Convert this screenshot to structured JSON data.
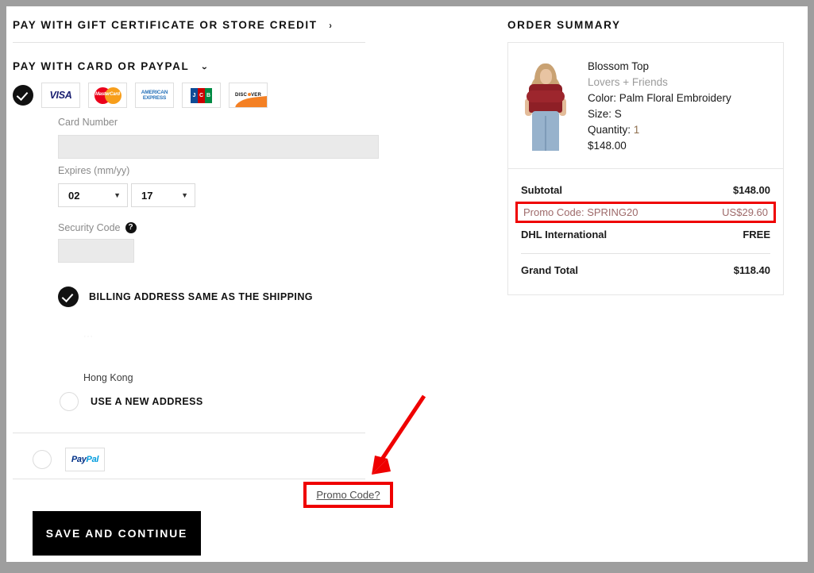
{
  "left": {
    "gift_section": {
      "title": "PAY WITH GIFT CERTIFICATE OR STORE CREDIT",
      "chevron": "›"
    },
    "card_section": {
      "title": "PAY WITH CARD OR PAYPAL",
      "chevron": "⌄"
    },
    "card_logos": [
      {
        "name": "visa-logo",
        "label": "VISA"
      },
      {
        "name": "mastercard-logo",
        "label": "MasterCard"
      },
      {
        "name": "amex-logo",
        "label_line1": "AMERICAN",
        "label_line2": "EXPRESS"
      },
      {
        "name": "jcb-logo",
        "l1": "J",
        "l2": "C",
        "l3": "B"
      },
      {
        "name": "discover-logo",
        "label_pre": "DISC",
        "label_post": "VER"
      }
    ],
    "form": {
      "card_number_label": "Card Number",
      "card_number_value": "",
      "expires_label": "Expires (mm/yy)",
      "expires_month": "02",
      "expires_year": "17",
      "select_arrow": "▼",
      "security_code_label": "Security Code",
      "security_help_icon": "?",
      "security_code_value": ""
    },
    "billing": {
      "same_as_shipping_label": "BILLING ADDRESS SAME AS THE SHIPPING",
      "obscured_address": "···",
      "country": "Hong Kong",
      "new_address_label": "USE A NEW ADDRESS"
    },
    "paypal": {
      "label": "PayPal",
      "pp_a": "Pay",
      "pp_b": "Pal"
    },
    "promo_link": "Promo Code?",
    "save_button": "SAVE AND CONTINUE"
  },
  "summary": {
    "title": "ORDER SUMMARY",
    "product": {
      "name": "Blossom Top",
      "brand": "Lovers + Friends",
      "color": "Color: Palm Floral Embroidery",
      "size": "Size: S",
      "quantity_label": "Quantity:",
      "quantity_value": "1",
      "price": "$148.00"
    },
    "totals": [
      {
        "label": "Subtotal",
        "value": "$148.00",
        "highlight": false
      },
      {
        "label": "Promo Code: SPRING20",
        "value": "US$29.60",
        "highlight": true
      },
      {
        "label": "DHL International",
        "value": "FREE",
        "highlight": false
      }
    ],
    "grand_total": {
      "label": "Grand Total",
      "value": "$118.40"
    }
  },
  "annotation": {
    "highlight_color": "#ef0000"
  }
}
